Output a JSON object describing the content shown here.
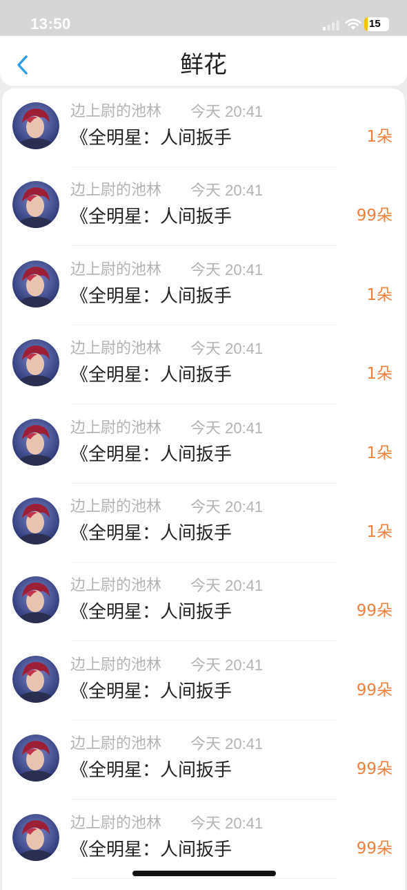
{
  "status_bar": {
    "time": "13:50",
    "battery": "15",
    "battery_color": "#f2c400"
  },
  "nav": {
    "title": "鲜花",
    "back_icon": "chevron-left-icon",
    "accent": "#2a9fe8"
  },
  "colors": {
    "amount": "#f0803c",
    "meta_text": "#b3b3b3",
    "title_text": "#222222"
  },
  "rows": [
    {
      "name": "边上尉的池林",
      "time": "今天 20:41",
      "title": "《全明星：人间扳手",
      "amount": "1朵"
    },
    {
      "name": "边上尉的池林",
      "time": "今天 20:41",
      "title": "《全明星：人间扳手",
      "amount": "99朵"
    },
    {
      "name": "边上尉的池林",
      "time": "今天 20:41",
      "title": "《全明星：人间扳手",
      "amount": "1朵"
    },
    {
      "name": "边上尉的池林",
      "time": "今天 20:41",
      "title": "《全明星：人间扳手",
      "amount": "1朵"
    },
    {
      "name": "边上尉的池林",
      "time": "今天 20:41",
      "title": "《全明星：人间扳手",
      "amount": "1朵"
    },
    {
      "name": "边上尉的池林",
      "time": "今天 20:41",
      "title": "《全明星：人间扳手",
      "amount": "1朵"
    },
    {
      "name": "边上尉的池林",
      "time": "今天 20:41",
      "title": "《全明星：人间扳手",
      "amount": "99朵"
    },
    {
      "name": "边上尉的池林",
      "time": "今天 20:41",
      "title": "《全明星：人间扳手",
      "amount": "99朵"
    },
    {
      "name": "边上尉的池林",
      "time": "今天 20:41",
      "title": "《全明星：人间扳手",
      "amount": "99朵"
    },
    {
      "name": "边上尉的池林",
      "time": "今天 20:41",
      "title": "《全明星：人间扳手",
      "amount": "99朵"
    }
  ]
}
